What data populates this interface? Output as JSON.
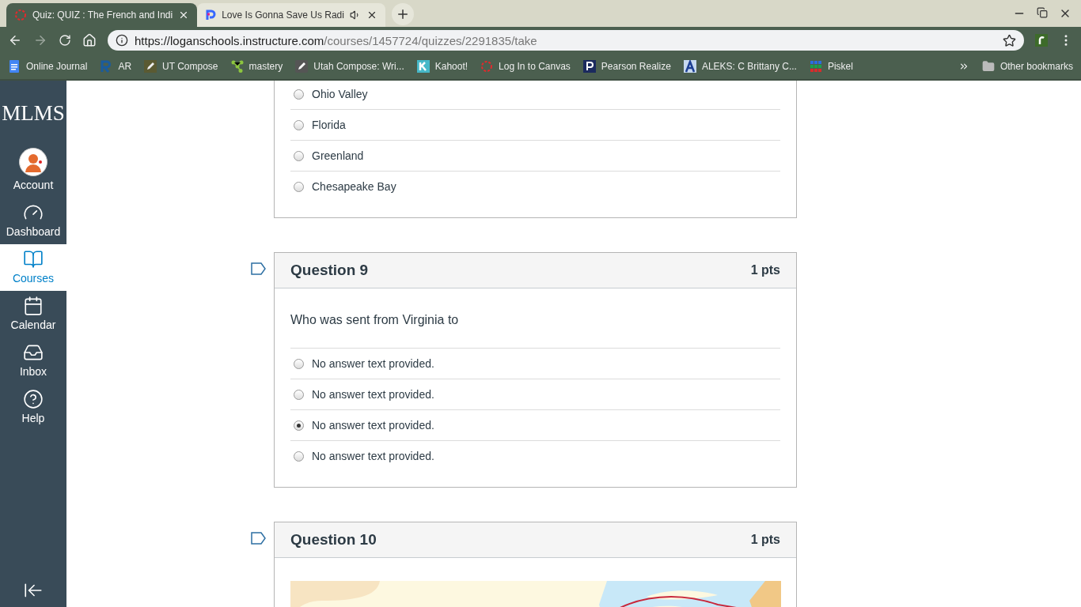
{
  "browser": {
    "tabs": [
      {
        "title": "Quiz: QUIZ : The French and Indi",
        "selected": true,
        "audio": false
      },
      {
        "title": "Love Is Gonna Save Us Radi",
        "selected": false,
        "audio": true
      }
    ],
    "url_host": "https://loganschools.instructure.com",
    "url_path": "/courses/1457724/quizzes/2291835/take",
    "bookmarks": [
      {
        "label": "Online Journal"
      },
      {
        "label": "AR"
      },
      {
        "label": "UT Compose"
      },
      {
        "label": "mastery"
      },
      {
        "label": "Utah Compose: Wri..."
      },
      {
        "label": "Kahoot!"
      },
      {
        "label": "Log In to Canvas"
      },
      {
        "label": "Pearson Realize"
      },
      {
        "label": "ALEKS: C Brittany C..."
      },
      {
        "label": "Piskel"
      }
    ],
    "other_bookmarks": "Other bookmarks"
  },
  "sidebar": {
    "logo": "MLMS",
    "items": [
      {
        "label": "Account",
        "selected": false
      },
      {
        "label": "Dashboard",
        "selected": false
      },
      {
        "label": "Courses",
        "selected": true
      },
      {
        "label": "Calendar",
        "selected": false
      },
      {
        "label": "Inbox",
        "selected": false
      },
      {
        "label": "Help",
        "selected": false
      }
    ]
  },
  "previous_answers": [
    {
      "text": "Ohio Valley",
      "selected": false
    },
    {
      "text": "Florida",
      "selected": false
    },
    {
      "text": "Greenland",
      "selected": false
    },
    {
      "text": "Chesapeake Bay",
      "selected": false
    }
  ],
  "questions": [
    {
      "title": "Question 9",
      "points": "1 pts",
      "text": "Who was sent from Virginia to",
      "answers": [
        {
          "text": "No answer text provided.",
          "selected": false
        },
        {
          "text": "No answer text provided.",
          "selected": false
        },
        {
          "text": "No answer text provided.",
          "selected": true
        },
        {
          "text": "No answer text provided.",
          "selected": false
        }
      ]
    },
    {
      "title": "Question 10",
      "points": "1 pts"
    }
  ]
}
